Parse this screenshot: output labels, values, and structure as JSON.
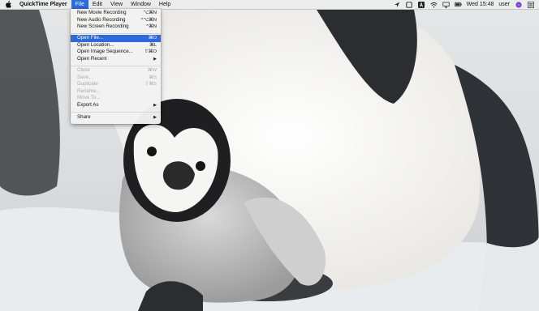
{
  "menubar": {
    "app_name": "QuickTime Player",
    "menus": [
      "File",
      "Edit",
      "View",
      "Window",
      "Help"
    ],
    "active_menu": "File",
    "clock": "Wed 15:48",
    "user": "user",
    "status_icons": [
      "location-icon",
      "square-icon",
      "adobe-icon",
      "wifi-icon",
      "airplay-icon",
      "battery-icon",
      "siri-icon",
      "notification-list-icon"
    ]
  },
  "file_menu": {
    "items": [
      {
        "label": "New Movie Recording",
        "shortcut": "⌥⌘N",
        "disabled": false
      },
      {
        "label": "New Audio Recording",
        "shortcut": "^⌥⌘N",
        "disabled": false
      },
      {
        "label": "New Screen Recording",
        "shortcut": "^⌘N",
        "disabled": false
      },
      {
        "label": "Open File...",
        "shortcut": "⌘O",
        "disabled": false,
        "highlighted": true
      },
      {
        "label": "Open Location...",
        "shortcut": "⌘L",
        "disabled": false
      },
      {
        "label": "Open Image Sequence...",
        "shortcut": "⇧⌘O",
        "disabled": false
      },
      {
        "label": "Open Recent",
        "submenu": true,
        "disabled": false
      },
      {
        "label": "Close",
        "shortcut": "⌘W",
        "disabled": true
      },
      {
        "label": "Save...",
        "shortcut": "⌘S",
        "disabled": true
      },
      {
        "label": "Duplicate",
        "shortcut": "⇧⌘S",
        "disabled": true
      },
      {
        "label": "Rename...",
        "disabled": true
      },
      {
        "label": "Move To...",
        "disabled": true
      },
      {
        "label": "Export As",
        "submenu": true,
        "disabled": false
      },
      {
        "label": "Share",
        "submenu": true,
        "disabled": false
      }
    ]
  },
  "colors": {
    "accent": "#2e6ad9",
    "menubar_bg": "#ececec"
  }
}
